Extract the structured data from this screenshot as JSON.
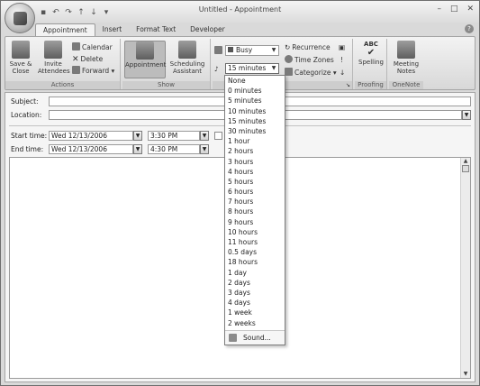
{
  "window": {
    "title": "Untitled - Appointment"
  },
  "tabs": [
    "Appointment",
    "Insert",
    "Format Text",
    "Developer"
  ],
  "ribbon": {
    "actions": {
      "label": "Actions",
      "save_close": "Save &\nClose",
      "invite": "Invite\nAttendees",
      "calendar": "Calendar",
      "delete": "Delete",
      "forward": "Forward"
    },
    "show": {
      "label": "Show",
      "appointment": "Appointment",
      "scheduling": "Scheduling\nAssistant"
    },
    "options": {
      "busy": "Busy",
      "reminder": "15 minutes",
      "recurrence": "Recurrence",
      "time_zones": "Time Zones",
      "categorize": "Categorize"
    },
    "proofing": {
      "label": "Proofing",
      "spelling": "Spelling"
    },
    "onenote": {
      "label": "OneNote",
      "meeting_notes": "Meeting\nNotes"
    }
  },
  "form": {
    "subject_label": "Subject:",
    "location_label": "Location:",
    "start_label": "Start time:",
    "end_label": "End time:",
    "start_date": "Wed 12/13/2006",
    "start_time": "3:30 PM",
    "end_date": "Wed 12/13/2006",
    "end_time": "4:30 PM"
  },
  "reminder_options": [
    "None",
    "0 minutes",
    "5 minutes",
    "10 minutes",
    "15 minutes",
    "30 minutes",
    "1 hour",
    "2 hours",
    "3 hours",
    "4 hours",
    "5 hours",
    "6 hours",
    "7 hours",
    "8 hours",
    "9 hours",
    "10 hours",
    "11 hours",
    "0.5 days",
    "18 hours",
    "1 day",
    "2 days",
    "3 days",
    "4 days",
    "1 week",
    "2 weeks"
  ],
  "sound_label": "Sound..."
}
